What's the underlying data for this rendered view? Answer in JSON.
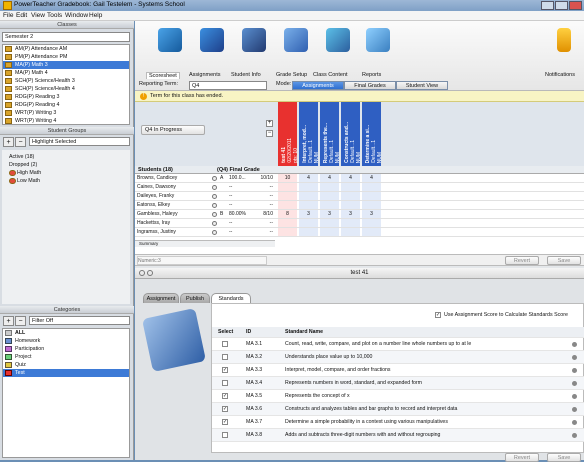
{
  "window": {
    "title": "PowerTeacher Gradebook: Gail Testelem - Systems School"
  },
  "menu": [
    "File",
    "Edit",
    "View",
    "Tools",
    "Window",
    "Help"
  ],
  "classes": {
    "header": "Classes",
    "term": "Semester 2",
    "items": [
      "AM(P) Attendance AM",
      "PM(P) Attendance PM",
      "MA(P) Math 3",
      "MA(P) Math 4",
      "SCH(P) Science/Health 3",
      "SCH(P) Science/Health 4",
      "RDG(P) Reading 3",
      "RDG(P) Reading 4",
      "WRT(P) Writing 3",
      "WRT(P) Writing 4"
    ]
  },
  "student_groups": {
    "header": "Student Groups",
    "filter": "Highlight Selected",
    "tree": [
      "Active (18)",
      "Dropped (2)",
      "High Math",
      "Low Math"
    ]
  },
  "categories": {
    "header": "Categories",
    "filter": "Filter Off",
    "items": [
      "ALL",
      "Homework",
      "Participation",
      "Project",
      "Quiz",
      "Test"
    ]
  },
  "toolbar": {
    "tabs": [
      "Scoresheet",
      "Assignments",
      "Student Info",
      "Grade Setup",
      "Class Content",
      "Reports"
    ],
    "notifications": "Notifications"
  },
  "reporting": {
    "label": "Reporting Term:",
    "term": "Q4",
    "mode_label": "Mode:",
    "modes": [
      "Assignments",
      "Final Grades",
      "Student View"
    ]
  },
  "notice": "Term for this class has ended.",
  "grid": {
    "term_button": "Q4 In Progress",
    "students_header": "Students (18)",
    "final_header": "(Q4) Final Grade",
    "columns": [
      {
        "title": "test 41",
        "sub": "02/20/2011",
        "pts": "pts: 10"
      },
      {
        "title": "Interpret, mod...",
        "sub": "Default...1",
        "pts": "NUM"
      },
      {
        "title": "Represents the...",
        "sub": "Default...1",
        "pts": "NUM"
      },
      {
        "title": "Constructs and...",
        "sub": "Default...1",
        "pts": "NUM"
      },
      {
        "title": "Determine a si...",
        "sub": "Default...1",
        "pts": "NUM"
      }
    ],
    "rows": [
      {
        "name": "Browns, Candicey",
        "grade": "A",
        "pct": "100.0...",
        "score": "10/10",
        "vals": [
          "10",
          "4",
          "4",
          "4",
          "4"
        ]
      },
      {
        "name": "Caines, Dawsony",
        "grade": "",
        "pct": "--",
        "score": "--",
        "vals": [
          "",
          "",
          "",
          "",
          ""
        ]
      },
      {
        "name": "Daileyes, Franky",
        "grade": "",
        "pct": "--",
        "score": "--",
        "vals": [
          "",
          "",
          "",
          "",
          ""
        ]
      },
      {
        "name": "Eatonss, Elkey",
        "grade": "",
        "pct": "--",
        "score": "--",
        "vals": [
          "",
          "",
          "",
          "",
          ""
        ]
      },
      {
        "name": "Gambless, Haleyy",
        "grade": "B",
        "pct": "80.00%",
        "score": "8/10",
        "vals": [
          "8",
          "3",
          "3",
          "3",
          "3"
        ]
      },
      {
        "name": "Hackettss, Iray",
        "grade": "",
        "pct": "--",
        "score": "--",
        "vals": [
          "",
          "",
          "",
          "",
          ""
        ]
      },
      {
        "name": "Ingramss, Justiny",
        "grade": "",
        "pct": "--",
        "score": "--",
        "vals": [
          "",
          "",
          "",
          "",
          ""
        ]
      }
    ],
    "summary": "Summary"
  },
  "numeric": {
    "placeholder": "Numeric:3",
    "revert": "Revert",
    "save": "Save"
  },
  "detail": {
    "title": "test 41",
    "tabs": [
      "Assignment",
      "Publish",
      "Standards"
    ],
    "use_score_label": "Use Assignment Score to Calculate Standards Score",
    "headers": {
      "select": "Select",
      "id": "ID",
      "name": "Standard Name"
    },
    "standards": [
      {
        "checked": false,
        "id": "MA 3.1",
        "name": "Count, read, write, compare, and plot on a number line whole numbers up to at le"
      },
      {
        "checked": false,
        "id": "MA 3.2",
        "name": "Understands place value up to 10,000"
      },
      {
        "checked": true,
        "id": "MA 3.3",
        "name": "Interpret, model, compare, and order fractions"
      },
      {
        "checked": false,
        "id": "MA 3.4",
        "name": "Represents numbers in word, standard, and expanded form"
      },
      {
        "checked": true,
        "id": "MA 3.5",
        "name": "Represents the concept of x"
      },
      {
        "checked": true,
        "id": "MA 3.6",
        "name": "Constructs and analyzes tables and bar graphs to record and interpret data"
      },
      {
        "checked": true,
        "id": "MA 3.7",
        "name": "Determine a simple probability in a context using various manipulatives"
      },
      {
        "checked": false,
        "id": "MA 3.8",
        "name": "Adds and subtracts three-digit numbers with and without regrouping"
      }
    ],
    "revert": "Revert",
    "save": "Save"
  },
  "colors": {
    "selected": "#3d7ad6",
    "assignment_col": "#e8312f",
    "standard_col": "#2f5fc2",
    "notice": "#f8f4c4"
  }
}
